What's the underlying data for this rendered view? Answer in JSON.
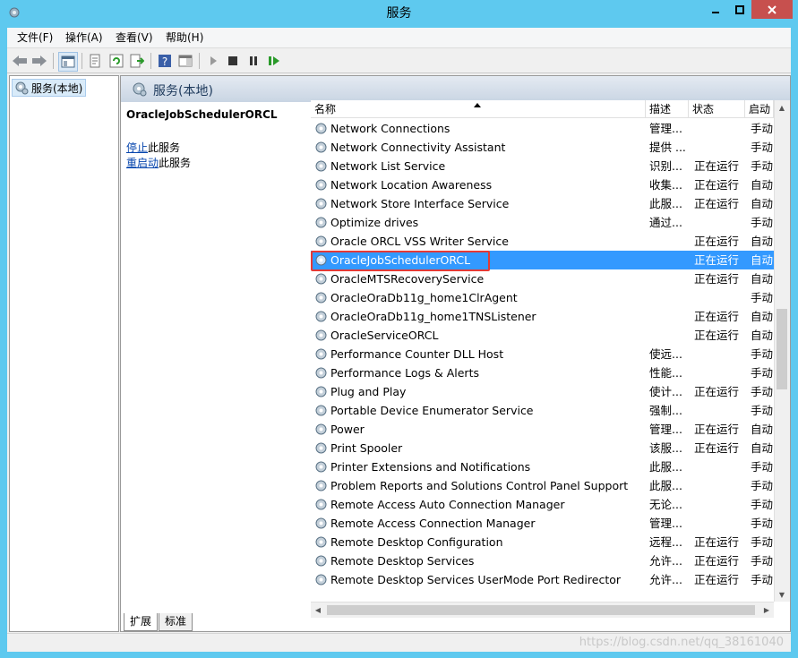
{
  "window": {
    "title": "服务",
    "accent": "#5ec9ef",
    "close_color": "#c7504e",
    "min_icon": "minimize-icon",
    "max_icon": "maximize-icon",
    "close_icon": "close-icon"
  },
  "menu": {
    "items": [
      "文件(F)",
      "操作(A)",
      "查看(V)",
      "帮助(H)"
    ]
  },
  "toolbar": {
    "icons": [
      "back-arrow-icon",
      "forward-arrow-icon",
      "console-tree-icon",
      "properties-icon",
      "refresh-icon",
      "export-list-icon",
      "help-icon",
      "show-pane-icon",
      "start-service-icon",
      "stop-service-icon",
      "pause-service-icon",
      "restart-service-icon"
    ]
  },
  "tree": {
    "root_label": "服务(本地)"
  },
  "main": {
    "header_title": "服务(本地)",
    "selected_service_name": "OracleJobSchedulerORCL",
    "action_stop_link": "停止",
    "action_stop_suffix": "此服务",
    "action_restart_link": "重启动",
    "action_restart_suffix": "此服务"
  },
  "list": {
    "columns": [
      "名称",
      "描述",
      "状态",
      "启动"
    ],
    "selection_color": "#3399ff",
    "rows": [
      {
        "name": "Network Connections",
        "desc": "管理...",
        "status": "",
        "start": "手动"
      },
      {
        "name": "Network Connectivity Assistant",
        "desc": "提供 ...",
        "status": "",
        "start": "手动"
      },
      {
        "name": "Network List Service",
        "desc": "识别...",
        "status": "正在运行",
        "start": "手动"
      },
      {
        "name": "Network Location Awareness",
        "desc": "收集...",
        "status": "正在运行",
        "start": "自动"
      },
      {
        "name": "Network Store Interface Service",
        "desc": "此服...",
        "status": "正在运行",
        "start": "自动"
      },
      {
        "name": "Optimize drives",
        "desc": "通过...",
        "status": "",
        "start": "手动"
      },
      {
        "name": "Oracle ORCL VSS Writer Service",
        "desc": "",
        "status": "正在运行",
        "start": "自动"
      },
      {
        "name": "OracleJobSchedulerORCL",
        "desc": "",
        "status": "正在运行",
        "start": "自动"
      },
      {
        "name": "OracleMTSRecoveryService",
        "desc": "",
        "status": "正在运行",
        "start": "自动"
      },
      {
        "name": "OracleOraDb11g_home1ClrAgent",
        "desc": "",
        "status": "",
        "start": "手动"
      },
      {
        "name": "OracleOraDb11g_home1TNSListener",
        "desc": "",
        "status": "正在运行",
        "start": "自动"
      },
      {
        "name": "OracleServiceORCL",
        "desc": "",
        "status": "正在运行",
        "start": "自动"
      },
      {
        "name": "Performance Counter DLL Host",
        "desc": "使远...",
        "status": "",
        "start": "手动"
      },
      {
        "name": "Performance Logs & Alerts",
        "desc": "性能...",
        "status": "",
        "start": "手动"
      },
      {
        "name": "Plug and Play",
        "desc": "使计...",
        "status": "正在运行",
        "start": "手动"
      },
      {
        "name": "Portable Device Enumerator Service",
        "desc": "强制...",
        "status": "",
        "start": "手动"
      },
      {
        "name": "Power",
        "desc": "管理...",
        "status": "正在运行",
        "start": "自动"
      },
      {
        "name": "Print Spooler",
        "desc": "该服...",
        "status": "正在运行",
        "start": "自动"
      },
      {
        "name": "Printer Extensions and Notifications",
        "desc": "此服...",
        "status": "",
        "start": "手动"
      },
      {
        "name": "Problem Reports and Solutions Control Panel Support",
        "desc": "此服...",
        "status": "",
        "start": "手动"
      },
      {
        "name": "Remote Access Auto Connection Manager",
        "desc": "无论...",
        "status": "",
        "start": "手动"
      },
      {
        "name": "Remote Access Connection Manager",
        "desc": "管理...",
        "status": "",
        "start": "手动"
      },
      {
        "name": "Remote Desktop Configuration",
        "desc": "远程...",
        "status": "正在运行",
        "start": "手动"
      },
      {
        "name": "Remote Desktop Services",
        "desc": "允许...",
        "status": "正在运行",
        "start": "手动"
      },
      {
        "name": "Remote Desktop Services UserMode Port Redirector",
        "desc": "允许...",
        "status": "正在运行",
        "start": "手动"
      }
    ]
  },
  "tabs": [
    "扩展",
    "标准"
  ],
  "watermark": "https://blog.csdn.net/qq_38161040"
}
